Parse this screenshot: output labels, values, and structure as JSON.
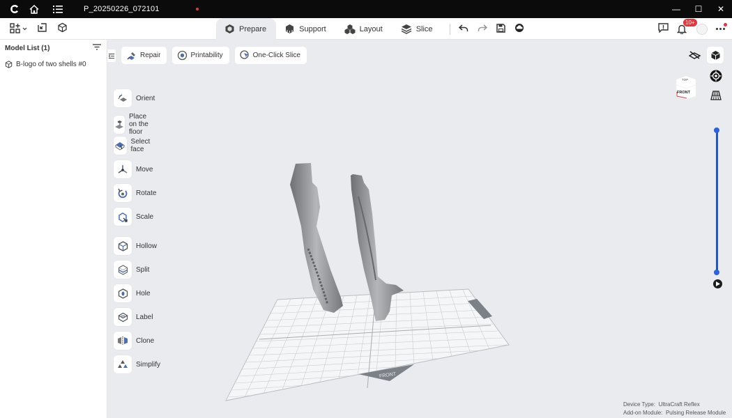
{
  "window": {
    "title": "P_20250226_072101",
    "controls": {
      "minimize": "—",
      "maximize": "☐",
      "close": "✕"
    }
  },
  "tabs": [
    {
      "label": "Prepare",
      "icon": "prepare-icon",
      "active": true
    },
    {
      "label": "Support",
      "icon": "support-icon",
      "active": false
    },
    {
      "label": "Layout",
      "icon": "layout-icon",
      "active": false
    },
    {
      "label": "Slice",
      "icon": "slice-icon",
      "active": false
    }
  ],
  "notifications": {
    "badge": "10+"
  },
  "sidebar": {
    "title": "Model List (1)",
    "items": [
      {
        "label": "B-logo of two shells #0"
      }
    ]
  },
  "top_actions": [
    {
      "label": "Repair",
      "icon": "repair-icon"
    },
    {
      "label": "Printability",
      "icon": "printability-icon"
    },
    {
      "label": "One-Click Slice",
      "icon": "one-click-slice-icon"
    }
  ],
  "tools": [
    {
      "label": "Orient",
      "icon": "orient-icon"
    },
    {
      "label": "Place on the floor",
      "icon": "place-floor-icon"
    },
    {
      "label": "Select face",
      "icon": "select-face-icon"
    },
    {
      "label": "Move",
      "icon": "move-icon"
    },
    {
      "label": "Rotate",
      "icon": "rotate-icon"
    },
    {
      "label": "Scale",
      "icon": "scale-icon"
    },
    {
      "label": "Hollow",
      "icon": "hollow-icon"
    },
    {
      "label": "Split",
      "icon": "split-icon"
    },
    {
      "label": "Hole",
      "icon": "hole-icon"
    },
    {
      "label": "Label",
      "icon": "label-icon"
    },
    {
      "label": "Clone",
      "icon": "clone-icon"
    },
    {
      "label": "Simplify",
      "icon": "simplify-icon"
    }
  ],
  "view_cube": {
    "top": "TOP",
    "front": "FRONT"
  },
  "plate": {
    "front_label": "FRONT"
  },
  "device": {
    "type_label": "Device Type:",
    "type_value": "UltraCraft Reflex",
    "module_label": "Add-on Module:",
    "module_value": "Pulsing Release Module"
  },
  "colors": {
    "accent": "#2a62e0",
    "badge": "#e5343a",
    "titlebar": "#0b0b0b"
  }
}
